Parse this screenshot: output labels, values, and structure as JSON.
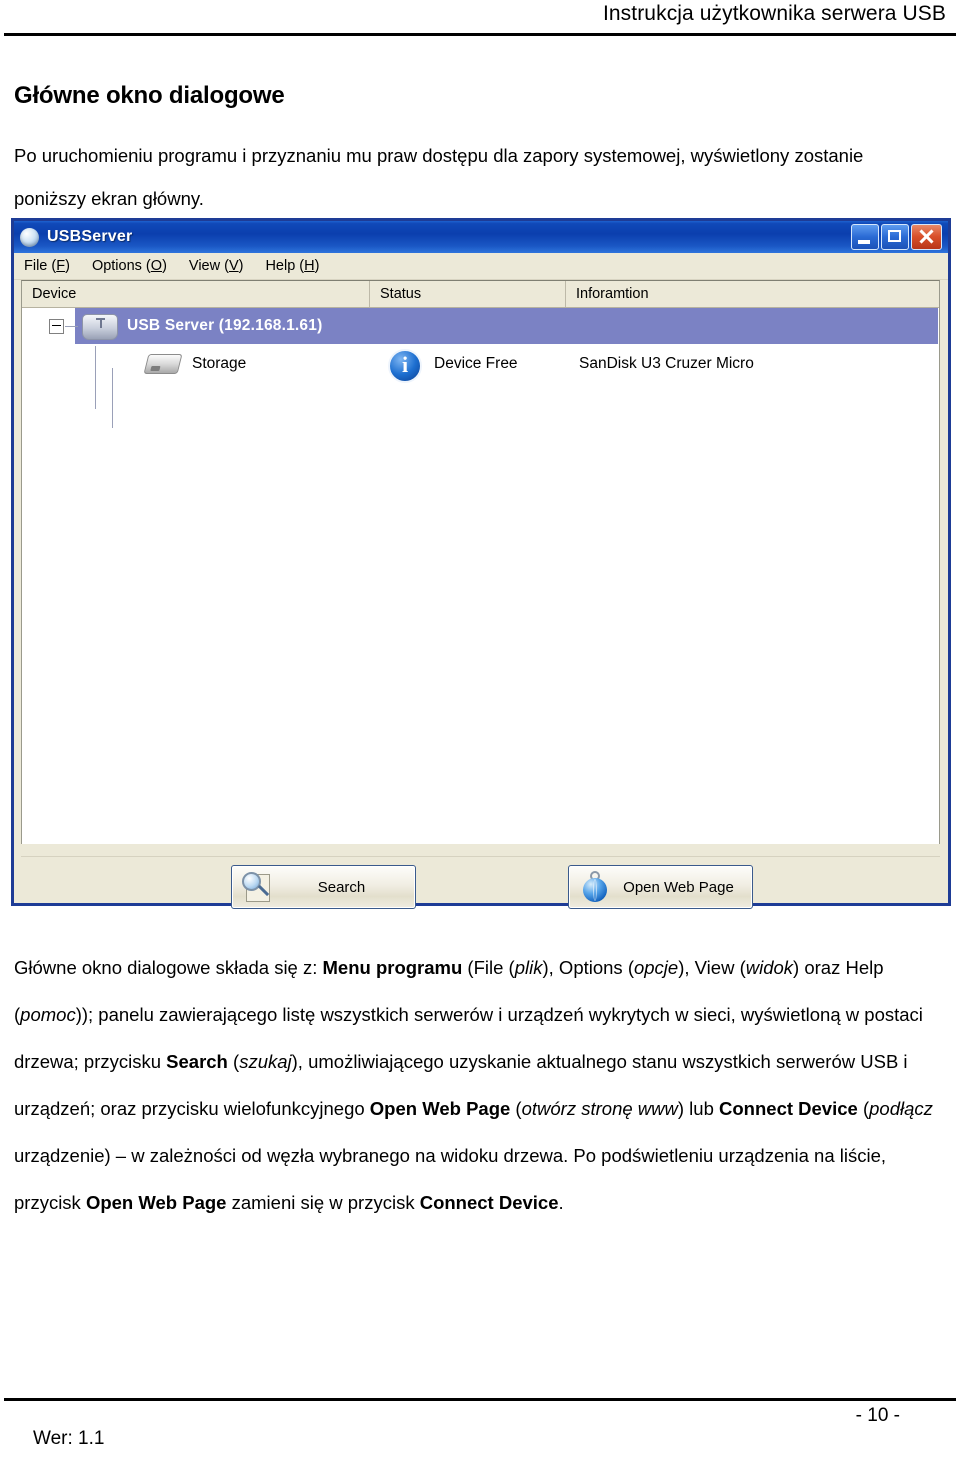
{
  "document": {
    "running_header": "Instrukcja użytkownika serwera USB",
    "title": "Główne okno dialogowe",
    "intro": "Po uruchomieniu programu i przyznaniu mu praw dostępu dla zapory systemowej, wyświetlony zostanie poniższy ekran główny.",
    "version": "Wer: 1.1",
    "page_number": "- 10 -"
  },
  "app": {
    "title": "USBServer",
    "window_controls": {
      "minimize": "Minimize",
      "maximize": "Maximize",
      "close": "Close"
    },
    "menu": [
      {
        "label": "File (F)",
        "text": "File (",
        "accel": "F",
        "tail": ")"
      },
      {
        "label": "Options (O)",
        "text": "Options (",
        "accel": "O",
        "tail": ")"
      },
      {
        "label": "View (V)",
        "text": "View (",
        "accel": "V",
        "tail": ")"
      },
      {
        "label": "Help (H)",
        "text": "Help (",
        "accel": "H",
        "tail": ")"
      }
    ],
    "columns": [
      "Device",
      "Status",
      "Inforamtion"
    ],
    "tree": {
      "server": {
        "label": "USB Server  (192.168.1.61)",
        "selected": true,
        "expanded": true
      },
      "children": [
        {
          "device": "Storage",
          "status": "Device Free",
          "information": "SanDisk U3 Cruzer Micro"
        }
      ]
    },
    "buttons": [
      {
        "label": "Search",
        "icon": "search-icon"
      },
      {
        "label": "Open Web Page",
        "icon": "globe-icon"
      }
    ],
    "colors": {
      "titlebar": "#0b3fae",
      "selection": "#7b82c4",
      "window_chrome": "#ece9d8",
      "border": "#1e3c96"
    }
  },
  "explanation": {
    "p1_a": "Główne okno dialogowe składa się z: ",
    "p1_b": "Menu programu",
    "p1_c": " (File (",
    "p1_d": "plik",
    "p1_e": "), Options (",
    "p1_f": "opcje",
    "p1_g": "), View (",
    "p1_h": "widok",
    "p1_i": ") oraz Help (",
    "p1_j": "pomoc",
    "p1_k": ")); panelu zawierającego listę wszystkich serwerów i urządzeń wykrytych w sieci, wyświetloną w postaci drzewa; przycisku ",
    "p1_l": "Search",
    "p1_m": " (",
    "p1_n": "szukaj",
    "p1_o": "), umożliwiającego uzyskanie aktualnego stanu wszystkich serwerów USB i urządzeń; oraz przycisku wielofunkcyjnego ",
    "p1_p": "Open Web Page",
    "p1_q": " (",
    "p1_r": "otwórz stronę www",
    "p1_s": ") lub ",
    "p1_t": "Connect Device",
    "p1_u": " (",
    "p1_v": "podłącz",
    "p1_w": " urządzenie) – w zależności od węzła wybranego na widoku drzewa. Po podświetleniu urządzenia na liście, przycisk ",
    "p1_x": "Open Web Page",
    "p1_y": " zamieni się w przycisk ",
    "p1_z": "Connect Device",
    "p1_end": "."
  }
}
